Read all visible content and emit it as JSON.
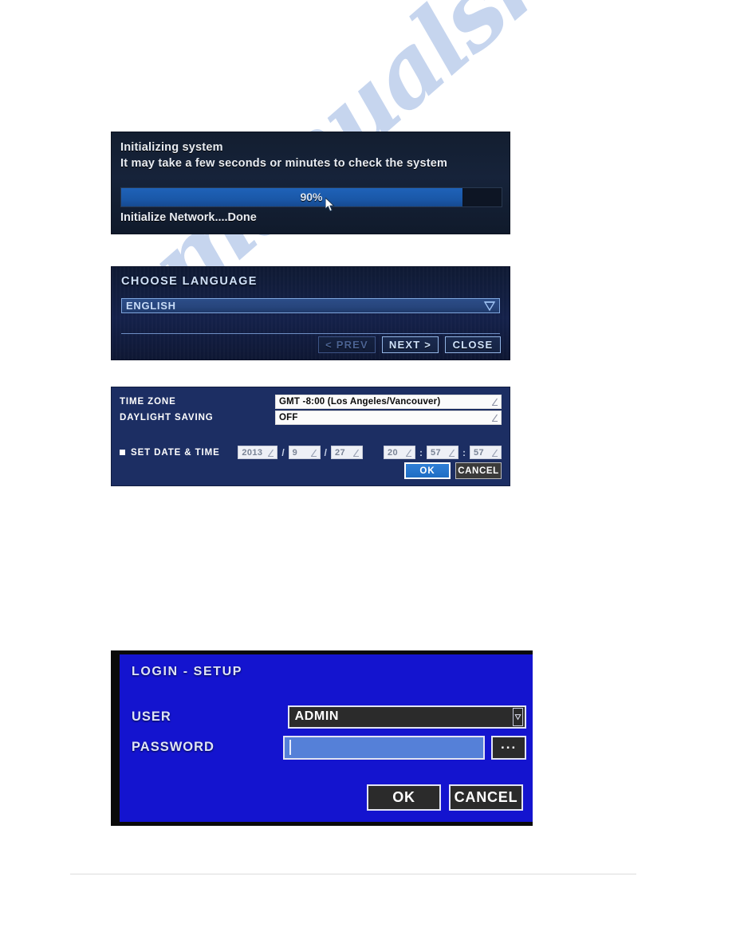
{
  "page": {
    "background": "#ffffff",
    "watermark_text": "manualshive.com",
    "watermark_color": "#c3d3ee"
  },
  "init_panel": {
    "title": "Initializing system",
    "subtitle": "It may take a few seconds or minutes to check the system",
    "progress_percent": 90,
    "progress_label": "90%",
    "status": "Initialize Network....Done",
    "fill_color": "#1a58a8",
    "cursor_icon": "mouse-pointer-icon"
  },
  "language_panel": {
    "title": "CHOOSE LANGUAGE",
    "selected_language": "ENGLISH",
    "options": [
      "ENGLISH"
    ],
    "dropdown_icon": "chevron-down-icon",
    "buttons": [
      {
        "label": "< PREV",
        "state": "disabled"
      },
      {
        "label": "NEXT >",
        "state": "enabled"
      },
      {
        "label": "CLOSE",
        "state": "enabled"
      }
    ]
  },
  "time_panel": {
    "rows": [
      {
        "label": "TIME ZONE",
        "value": "GMT -8:00 (Los Angeles/Vancouver)"
      },
      {
        "label": "DAYLIGHT SAVING",
        "value": "OFF"
      }
    ],
    "set_date_time_label": "SET DATE & TIME",
    "date": {
      "year": "2013",
      "month": "9",
      "day": "27"
    },
    "time": {
      "hour": "20",
      "minute": "57",
      "second": "57"
    },
    "date_separator": "/",
    "time_separator": ":",
    "ok_label": "OK",
    "cancel_label": "CANCEL",
    "ok_color": "#1f6ec4",
    "panel_color": "#1c2e63"
  },
  "login_panel": {
    "title": "LOGIN - SETUP",
    "user_label": "USER",
    "user_value": "ADMIN",
    "user_dropdown_icon": "chevron-down-icon",
    "password_label": "PASSWORD",
    "password_value": "",
    "password_placeholder": "",
    "dots_button_label": "...",
    "ok_label": "OK",
    "cancel_label": "CANCEL",
    "panel_color": "#1414cf"
  }
}
